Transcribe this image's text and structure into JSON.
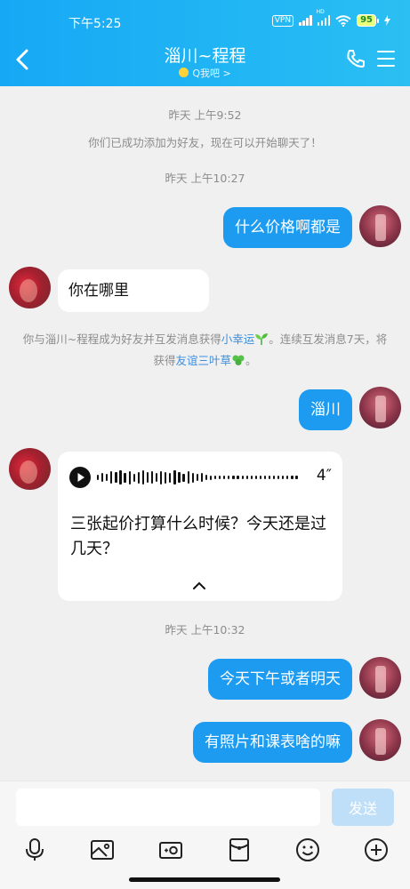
{
  "status_bar": {
    "time": "下午5:25",
    "vpn": "VPN",
    "battery": "95",
    "hd": "HD"
  },
  "header": {
    "title": "淄川~程程",
    "subtitle": "Q我吧 >"
  },
  "messages": {
    "time_1": "昨天 上午9:52",
    "added_note": "你们已成功添加为好友，现在可以开始聊天了！",
    "time_2": "昨天 上午10:27",
    "out_1": "什么价格啊都是",
    "in_1": "你在哪里",
    "luck_note": {
      "part1": "你与淄川~程程成为好友并互发消息获得",
      "link1": "小幸运",
      "part2": "。连续互发消息7天，将获得",
      "link2": "友谊三叶草",
      "part3": "。"
    },
    "out_2": "淄川",
    "voice": {
      "duration": "4″",
      "transcript": "三张起价打算什么时候？今天还是过几天？"
    },
    "time_3": "昨天 上午10:32",
    "out_3": "今天下午或者明天",
    "out_4": "有照片和课表啥的嘛"
  },
  "input": {
    "placeholder": "",
    "send_label": "发送"
  },
  "toolbar_icons": [
    "mic-icon",
    "image-icon",
    "camera-icon",
    "red-packet-icon",
    "emoji-icon",
    "plus-icon"
  ],
  "colors": {
    "header": "#1fb0f4",
    "bubble_out": "#1c9bf0",
    "bubble_in": "#ffffff",
    "link": "#3b8fe0"
  }
}
